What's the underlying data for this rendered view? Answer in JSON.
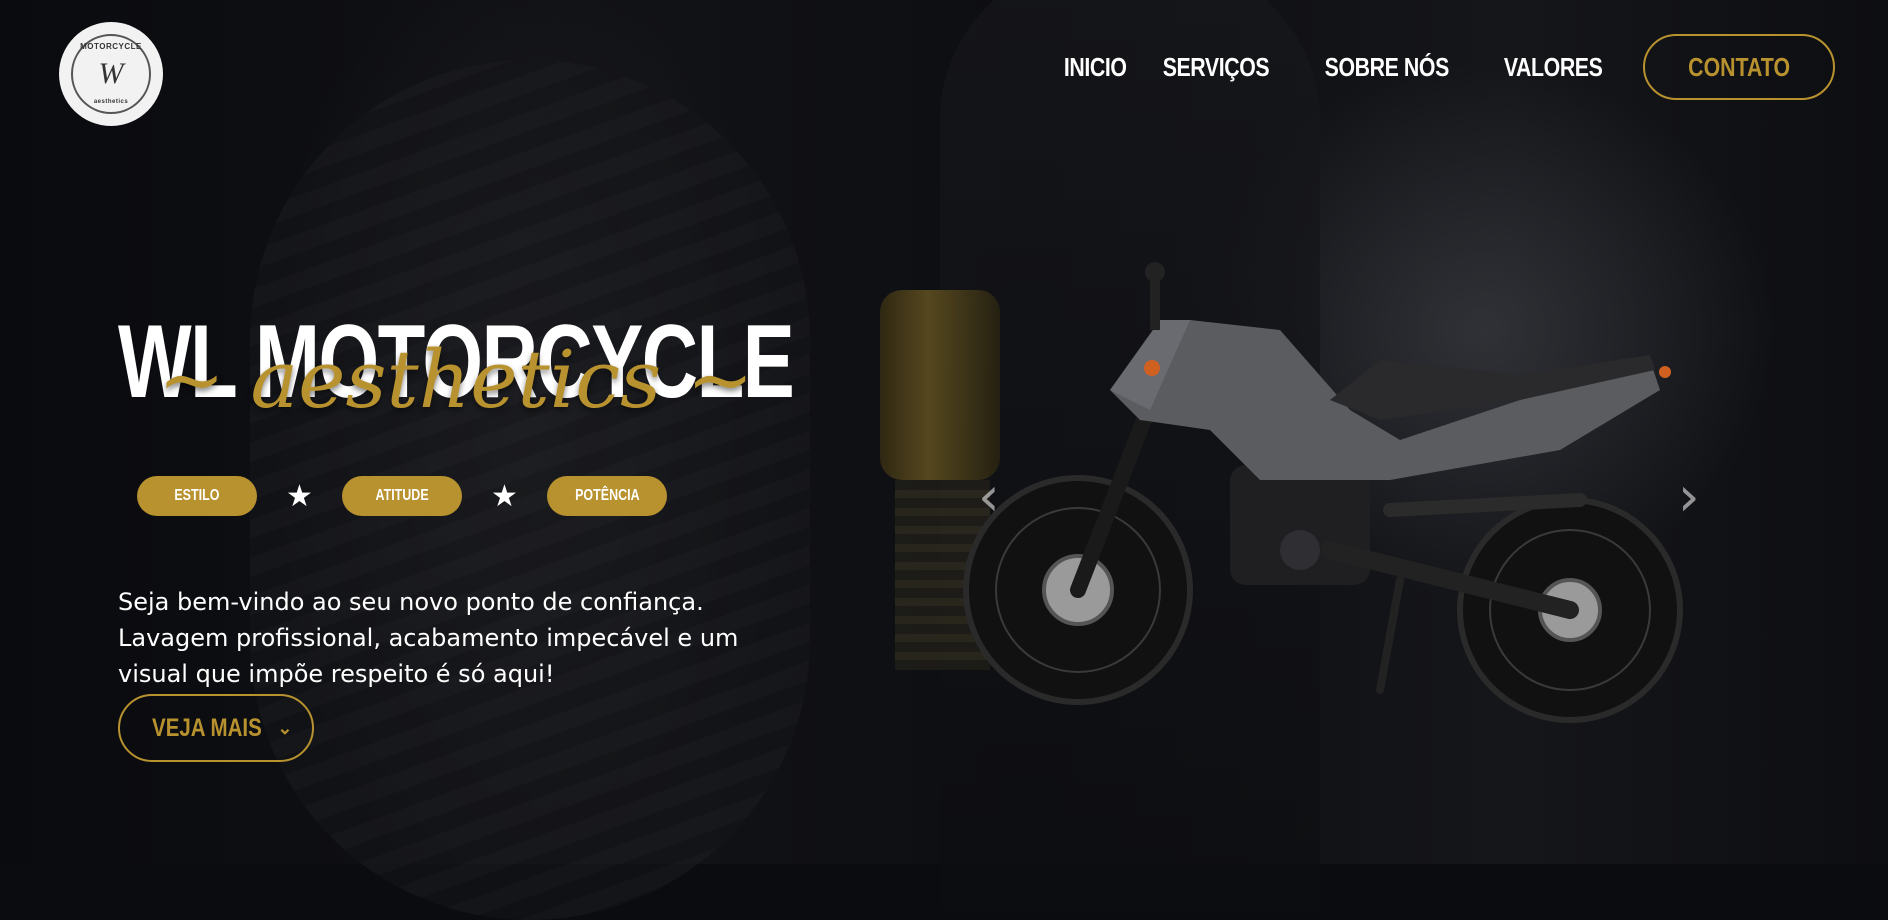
{
  "brand": {
    "logo_top_text": "MOTORCYCLE",
    "logo_monogram": "W",
    "logo_bottom_text": "aesthetics"
  },
  "nav": {
    "items": [
      {
        "label": "INICIO"
      },
      {
        "label": "SERVIÇOS"
      },
      {
        "label": "SOBRE NÓS"
      },
      {
        "label": "VALORES"
      }
    ],
    "contact_label": "CONTATO"
  },
  "hero": {
    "title": "WL MOTORCYCLE",
    "subtitle": "~ aesthetics ~",
    "tags": [
      {
        "label": "ESTILO"
      },
      {
        "label": "ATITUDE"
      },
      {
        "label": "POTÊNCIA"
      }
    ],
    "tag_separator_icon": "star-icon",
    "description": "Seja bem-vindo ao seu novo ponto de confiança. Lavagem profissional, acabamento impecável e um visual que impõe respeito é só aqui!",
    "more_label": "VEJA MAIS"
  },
  "carousel": {
    "prev_icon": "chevron-left-icon",
    "next_icon": "chevron-right-icon",
    "image": "motorcycle-image"
  },
  "colors": {
    "accent": "#b8922e",
    "background": "#0b0c10",
    "text": "#ffffff"
  }
}
